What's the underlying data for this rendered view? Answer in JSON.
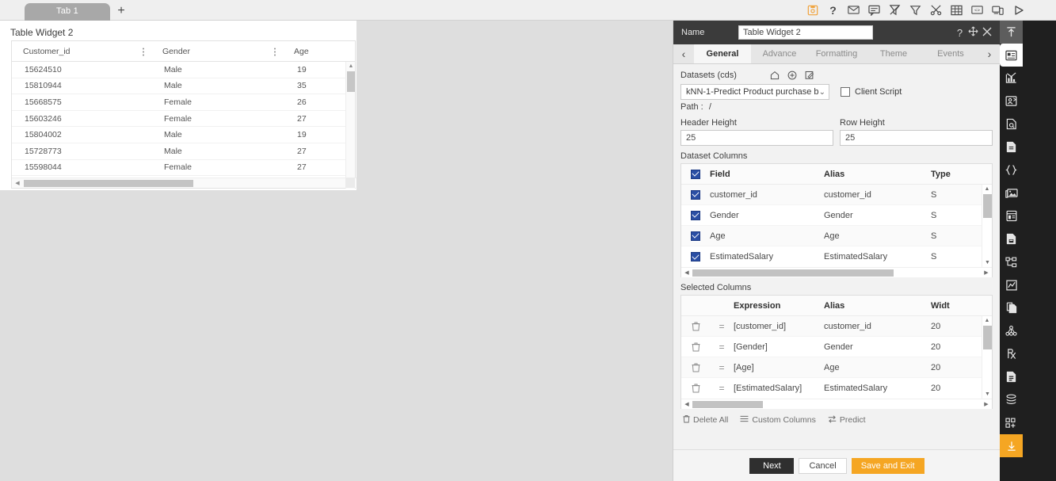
{
  "workspace": {
    "tab_label": "Tab 1",
    "add_tab_label": "+"
  },
  "widget": {
    "title": "Table Widget 2",
    "grid": {
      "columns": [
        "Customer_id",
        "Gender",
        "Age"
      ],
      "rows": [
        [
          "15624510",
          "Male",
          "19"
        ],
        [
          "15810944",
          "Male",
          "35"
        ],
        [
          "15668575",
          "Female",
          "26"
        ],
        [
          "15603246",
          "Female",
          "27"
        ],
        [
          "15804002",
          "Male",
          "19"
        ],
        [
          "15728773",
          "Male",
          "27"
        ],
        [
          "15598044",
          "Female",
          "27"
        ]
      ]
    }
  },
  "top_toolbar": {
    "icons": [
      "save-icon",
      "help-icon",
      "mail-icon",
      "comment-icon",
      "clear-filter-icon",
      "filter-icon",
      "tools-icon",
      "table-icon",
      "console-icon",
      "copy-screen-icon",
      "run-icon"
    ]
  },
  "panel": {
    "title_label": "Name",
    "name_value": "Table Widget 2",
    "title_icons": [
      "help-icon",
      "move-icon",
      "close-icon"
    ],
    "tabs": [
      {
        "label": "General",
        "active": true
      },
      {
        "label": "Advance",
        "active": false
      },
      {
        "label": "Formatting",
        "active": false
      },
      {
        "label": "Theme",
        "active": false
      },
      {
        "label": "Events",
        "active": false
      }
    ],
    "datasets": {
      "label": "Datasets (cds)",
      "icons": [
        "home-icon",
        "add-circle-icon",
        "edit-icon"
      ],
      "selected": "kNN-1-Predict Product purchase b...",
      "client_script_label": "Client Script",
      "client_script_checked": false,
      "path_label": "Path :",
      "path_value": "/"
    },
    "header_height": {
      "label": "Header Height",
      "value": "25"
    },
    "row_height": {
      "label": "Row Height",
      "value": "25"
    },
    "dataset_columns": {
      "title": "Dataset Columns",
      "headers": [
        "Field",
        "Alias",
        "Type"
      ],
      "rows": [
        {
          "checked": true,
          "field": "customer_id",
          "alias": "customer_id",
          "type": "S"
        },
        {
          "checked": true,
          "field": "Gender",
          "alias": "Gender",
          "type": "S"
        },
        {
          "checked": true,
          "field": "Age",
          "alias": "Age",
          "type": "S"
        },
        {
          "checked": true,
          "field": "EstimatedSalary",
          "alias": "EstimatedSalary",
          "type": "S"
        }
      ],
      "header_checked": true
    },
    "selected_columns": {
      "title": "Selected Columns",
      "headers": [
        "Expression",
        "Alias",
        "Widt"
      ],
      "rows": [
        {
          "expression": "[customer_id]",
          "alias": "customer_id",
          "width": "20"
        },
        {
          "expression": "[Gender]",
          "alias": "Gender",
          "width": "20"
        },
        {
          "expression": "[Age]",
          "alias": "Age",
          "width": "20"
        },
        {
          "expression": "[EstimatedSalary]",
          "alias": "EstimatedSalary",
          "width": "20"
        }
      ]
    },
    "links": [
      {
        "label": "Delete All",
        "icon": "trash-icon"
      },
      {
        "label": "Custom Columns",
        "icon": "list-icon"
      },
      {
        "label": "Predict",
        "icon": "swap-icon"
      }
    ],
    "footer": {
      "next": "Next",
      "cancel": "Cancel",
      "save_and_exit": "Save and Exit"
    }
  },
  "rail": {
    "collapse_icon": "collapse-up-icon",
    "items": [
      "widget-panel-icon",
      "chart-icon",
      "map-icon",
      "data-search-icon",
      "document-icon",
      "code-braces-icon",
      "image-icon",
      "form-icon",
      "file-save-icon",
      "hierarchy-icon",
      "line-chart-icon",
      "duplicate-icon",
      "cluster-icon",
      "prescription-icon",
      "report-icon",
      "layers-icon",
      "add-module-icon",
      "download-icon"
    ],
    "selected_index": 0,
    "highlight_index": 17
  },
  "colors": {
    "accent_amber": "#f5a623",
    "panel_dark": "#3b3b3b",
    "rail_dark": "#1f1f1f",
    "checkbox_blue": "#2a4ea4",
    "canvas_gray": "#dedede"
  }
}
